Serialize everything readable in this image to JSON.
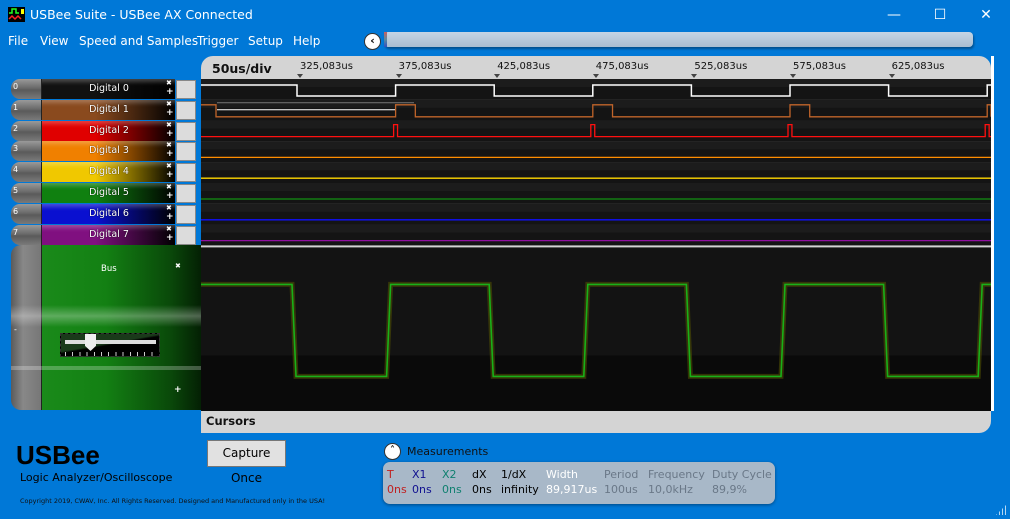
{
  "window": {
    "title": "USBee Suite - USBee AX Connected",
    "controls": {
      "minimize": "—",
      "maximize": "☐",
      "close": "✕"
    }
  },
  "menu": [
    "File",
    "View",
    "Speed and Samples",
    "Trigger",
    "Setup",
    "Help"
  ],
  "scrollbar": {
    "left_button": "‹"
  },
  "channels": [
    {
      "num": "0",
      "label": "Digital 0",
      "color": "#111111",
      "trace": "#ffffff"
    },
    {
      "num": "1",
      "label": "Digital 1",
      "color": "#8a4a1e",
      "trace": "#c0642a"
    },
    {
      "num": "2",
      "label": "Digital 2",
      "color": "#e00000",
      "trace": "#ff1010"
    },
    {
      "num": "3",
      "label": "Digital 3",
      "color": "#f08000",
      "trace": "#ff8c00"
    },
    {
      "num": "4",
      "label": "Digital 4",
      "color": "#f0c800",
      "trace": "#ffd700"
    },
    {
      "num": "5",
      "label": "Digital 5",
      "color": "#108010",
      "trace": "#109010"
    },
    {
      "num": "6",
      "label": "Digital 6",
      "color": "#0a10d0",
      "trace": "#1010ff"
    },
    {
      "num": "7",
      "label": "Digital 7",
      "color": "#801080",
      "trace": "#9010a0"
    }
  ],
  "channel_controls": {
    "remove": "✖",
    "add": "+"
  },
  "bus": {
    "label": "Bus",
    "remove": "✖",
    "minus": "-",
    "plus": "+",
    "slider_level": 0.25,
    "trace": "#19b019"
  },
  "timebase": {
    "div_label": "50us/div",
    "ticks": [
      "325,083us",
      "375,083us",
      "425,083us",
      "475,083us",
      "525,083us",
      "575,083us",
      "625,083us"
    ]
  },
  "cursors": {
    "label": "Cursors"
  },
  "signals": {
    "digital0": {
      "period_us": 100,
      "duty": 0.5
    },
    "digital1": {
      "period_us": 100,
      "pulse_us": 10
    },
    "digital2": {
      "period_us": 100,
      "pulse_us": 2
    },
    "bus_analog": {
      "period_us": 100,
      "duty": 0.47
    }
  },
  "branding": {
    "name": "USBee",
    "subtitle": "Logic Analyzer/Oscilloscope",
    "copyright": "Copyright 2019, CWAV, Inc. All Rights Reserved. Designed and Manufactured only in the USA!"
  },
  "actions": {
    "capture_once": "Capture Once"
  },
  "measurements": {
    "title": "Measurements",
    "toggle": "˄",
    "columns": [
      {
        "header": "T",
        "value": "0ns",
        "color": "#c02020"
      },
      {
        "header": "X1",
        "value": "0ns",
        "color": "#101090"
      },
      {
        "header": "X2",
        "value": "0ns",
        "color": "#108070"
      },
      {
        "header": "dX",
        "value": "0ns",
        "color": "#000000"
      },
      {
        "header": "1/dX",
        "value": "infinity",
        "color": "#000000"
      },
      {
        "header": "Width",
        "value": "89,917us",
        "color": "#ffffff"
      },
      {
        "header": "Period",
        "value": "100us",
        "color": "#6a7888"
      },
      {
        "header": "Frequency",
        "value": "10,0kHz",
        "color": "#6a7888"
      },
      {
        "header": "Duty Cycle",
        "value": "89,9%",
        "color": "#6a7888"
      }
    ]
  }
}
